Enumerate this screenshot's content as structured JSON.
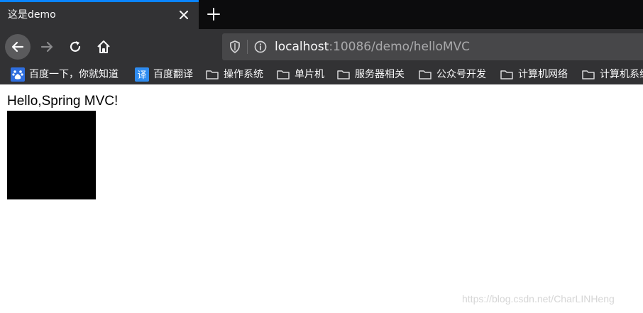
{
  "tab": {
    "title": "这是demo"
  },
  "address_bar": {
    "url_host": "localhost",
    "url_path": ":10086/demo/helloMVC"
  },
  "bookmarks": [
    {
      "label": "百度一下，你就知道",
      "icon": "baidu-icon"
    },
    {
      "label": "百度翻译",
      "icon": "translate-icon"
    },
    {
      "label": "操作系统",
      "icon": "folder-icon"
    },
    {
      "label": "单片机",
      "icon": "folder-icon"
    },
    {
      "label": "服务器相关",
      "icon": "folder-icon"
    },
    {
      "label": "公众号开发",
      "icon": "folder-icon"
    },
    {
      "label": "计算机网络",
      "icon": "folder-icon"
    },
    {
      "label": "计算机系统",
      "icon": "folder-icon"
    }
  ],
  "page": {
    "heading": "Hello,Spring MVC!",
    "watermark": "https://blog.csdn.net/CharLINHeng"
  },
  "colors": {
    "tab_accent": "#0a84ff",
    "toolbar_bg": "#323234",
    "tabstrip_bg": "#0c0c0d",
    "page_bg": "#ffffff"
  }
}
